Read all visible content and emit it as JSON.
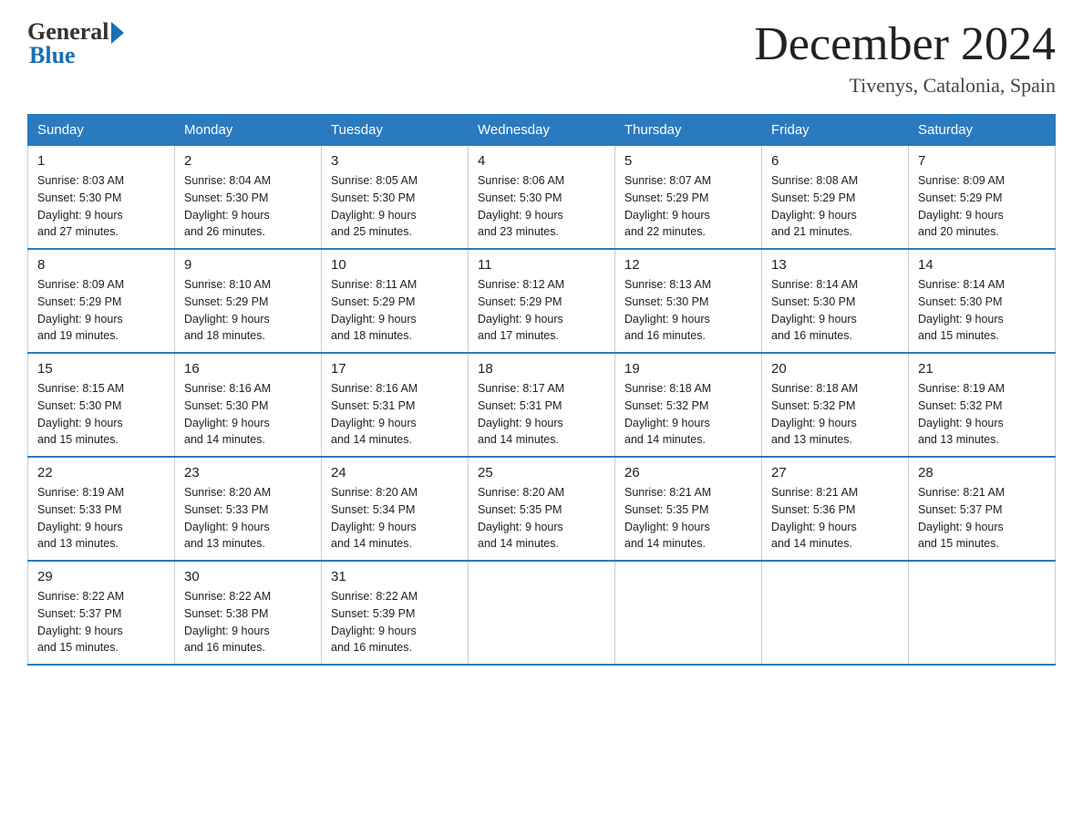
{
  "header": {
    "logo": {
      "general": "General",
      "blue": "Blue"
    },
    "title": "December 2024",
    "subtitle": "Tivenys, Catalonia, Spain"
  },
  "weekdays": [
    "Sunday",
    "Monday",
    "Tuesday",
    "Wednesday",
    "Thursday",
    "Friday",
    "Saturday"
  ],
  "weeks": [
    [
      {
        "day": "1",
        "sunrise": "8:03 AM",
        "sunset": "5:30 PM",
        "daylight": "9 hours and 27 minutes."
      },
      {
        "day": "2",
        "sunrise": "8:04 AM",
        "sunset": "5:30 PM",
        "daylight": "9 hours and 26 minutes."
      },
      {
        "day": "3",
        "sunrise": "8:05 AM",
        "sunset": "5:30 PM",
        "daylight": "9 hours and 25 minutes."
      },
      {
        "day": "4",
        "sunrise": "8:06 AM",
        "sunset": "5:30 PM",
        "daylight": "9 hours and 23 minutes."
      },
      {
        "day": "5",
        "sunrise": "8:07 AM",
        "sunset": "5:29 PM",
        "daylight": "9 hours and 22 minutes."
      },
      {
        "day": "6",
        "sunrise": "8:08 AM",
        "sunset": "5:29 PM",
        "daylight": "9 hours and 21 minutes."
      },
      {
        "day": "7",
        "sunrise": "8:09 AM",
        "sunset": "5:29 PM",
        "daylight": "9 hours and 20 minutes."
      }
    ],
    [
      {
        "day": "8",
        "sunrise": "8:09 AM",
        "sunset": "5:29 PM",
        "daylight": "9 hours and 19 minutes."
      },
      {
        "day": "9",
        "sunrise": "8:10 AM",
        "sunset": "5:29 PM",
        "daylight": "9 hours and 18 minutes."
      },
      {
        "day": "10",
        "sunrise": "8:11 AM",
        "sunset": "5:29 PM",
        "daylight": "9 hours and 18 minutes."
      },
      {
        "day": "11",
        "sunrise": "8:12 AM",
        "sunset": "5:29 PM",
        "daylight": "9 hours and 17 minutes."
      },
      {
        "day": "12",
        "sunrise": "8:13 AM",
        "sunset": "5:30 PM",
        "daylight": "9 hours and 16 minutes."
      },
      {
        "day": "13",
        "sunrise": "8:14 AM",
        "sunset": "5:30 PM",
        "daylight": "9 hours and 16 minutes."
      },
      {
        "day": "14",
        "sunrise": "8:14 AM",
        "sunset": "5:30 PM",
        "daylight": "9 hours and 15 minutes."
      }
    ],
    [
      {
        "day": "15",
        "sunrise": "8:15 AM",
        "sunset": "5:30 PM",
        "daylight": "9 hours and 15 minutes."
      },
      {
        "day": "16",
        "sunrise": "8:16 AM",
        "sunset": "5:30 PM",
        "daylight": "9 hours and 14 minutes."
      },
      {
        "day": "17",
        "sunrise": "8:16 AM",
        "sunset": "5:31 PM",
        "daylight": "9 hours and 14 minutes."
      },
      {
        "day": "18",
        "sunrise": "8:17 AM",
        "sunset": "5:31 PM",
        "daylight": "9 hours and 14 minutes."
      },
      {
        "day": "19",
        "sunrise": "8:18 AM",
        "sunset": "5:32 PM",
        "daylight": "9 hours and 14 minutes."
      },
      {
        "day": "20",
        "sunrise": "8:18 AM",
        "sunset": "5:32 PM",
        "daylight": "9 hours and 13 minutes."
      },
      {
        "day": "21",
        "sunrise": "8:19 AM",
        "sunset": "5:32 PM",
        "daylight": "9 hours and 13 minutes."
      }
    ],
    [
      {
        "day": "22",
        "sunrise": "8:19 AM",
        "sunset": "5:33 PM",
        "daylight": "9 hours and 13 minutes."
      },
      {
        "day": "23",
        "sunrise": "8:20 AM",
        "sunset": "5:33 PM",
        "daylight": "9 hours and 13 minutes."
      },
      {
        "day": "24",
        "sunrise": "8:20 AM",
        "sunset": "5:34 PM",
        "daylight": "9 hours and 14 minutes."
      },
      {
        "day": "25",
        "sunrise": "8:20 AM",
        "sunset": "5:35 PM",
        "daylight": "9 hours and 14 minutes."
      },
      {
        "day": "26",
        "sunrise": "8:21 AM",
        "sunset": "5:35 PM",
        "daylight": "9 hours and 14 minutes."
      },
      {
        "day": "27",
        "sunrise": "8:21 AM",
        "sunset": "5:36 PM",
        "daylight": "9 hours and 14 minutes."
      },
      {
        "day": "28",
        "sunrise": "8:21 AM",
        "sunset": "5:37 PM",
        "daylight": "9 hours and 15 minutes."
      }
    ],
    [
      {
        "day": "29",
        "sunrise": "8:22 AM",
        "sunset": "5:37 PM",
        "daylight": "9 hours and 15 minutes."
      },
      {
        "day": "30",
        "sunrise": "8:22 AM",
        "sunset": "5:38 PM",
        "daylight": "9 hours and 16 minutes."
      },
      {
        "day": "31",
        "sunrise": "8:22 AM",
        "sunset": "5:39 PM",
        "daylight": "9 hours and 16 minutes."
      },
      null,
      null,
      null,
      null
    ]
  ],
  "labels": {
    "sunrise": "Sunrise:",
    "sunset": "Sunset:",
    "daylight": "Daylight:"
  }
}
